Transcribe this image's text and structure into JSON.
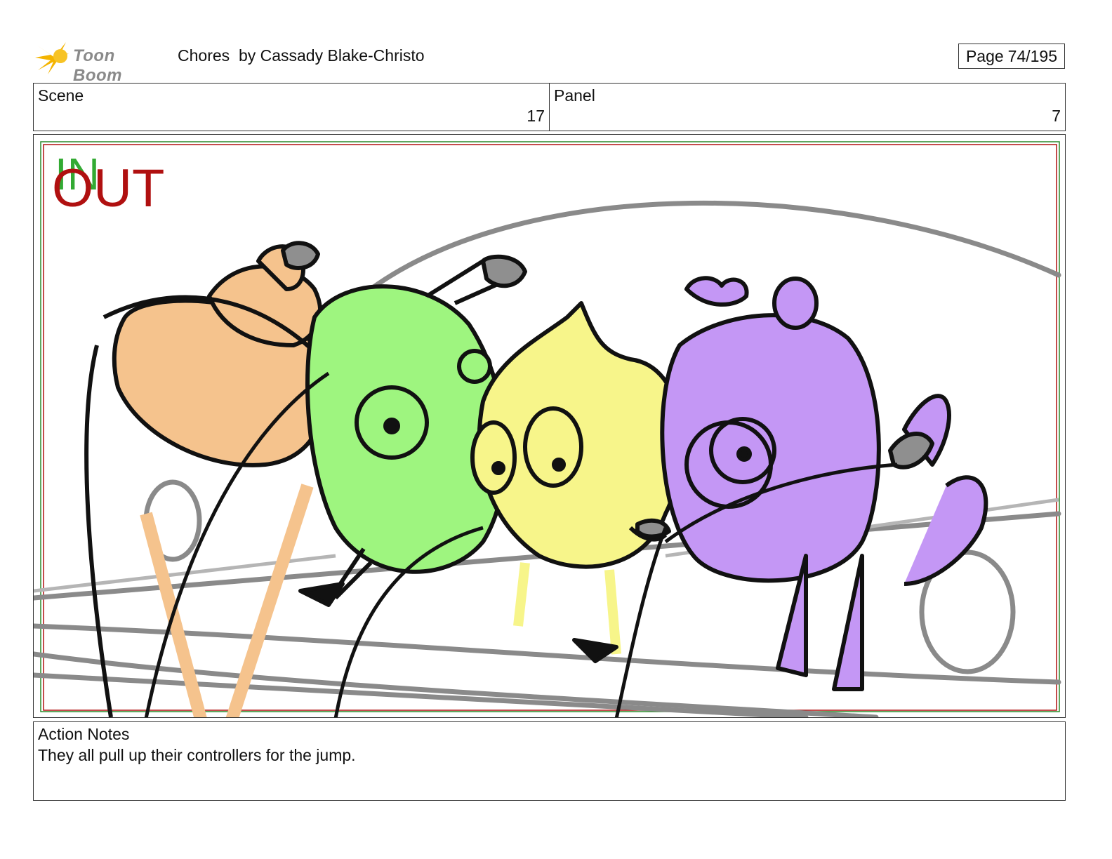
{
  "header": {
    "logo_text": "Toon Boom",
    "title": "Chores",
    "author": "by Cassady Blake-Christo",
    "page_label": "Page",
    "page_value": "74/195"
  },
  "scene": {
    "label": "Scene",
    "value": "17"
  },
  "panel": {
    "label": "Panel",
    "value": "7"
  },
  "frame": {
    "in_marker": "IN",
    "out_marker": "OUT",
    "colors": {
      "in": "#33aa33",
      "out": "#b01010",
      "orange": "#f5c38d",
      "green": "#9ef57f",
      "yellow": "#f7f58a",
      "purple": "#c497f5",
      "controller": "#8f8f8f"
    }
  },
  "notes": {
    "label": "Action Notes",
    "text": "They all pull up their controllers for the jump."
  }
}
